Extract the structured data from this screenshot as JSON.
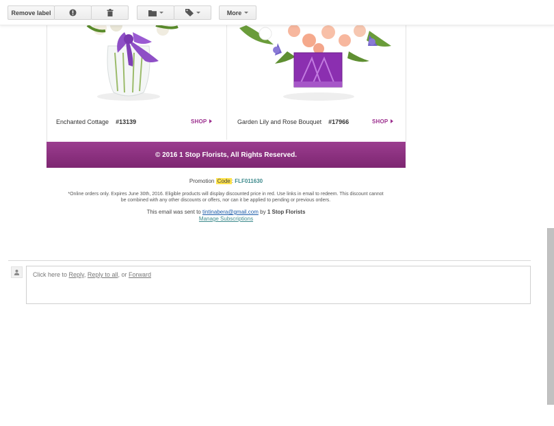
{
  "toolbar": {
    "remove_label": "Remove label",
    "more_label": "More",
    "icons": [
      "report-spam-icon",
      "delete-icon",
      "folder-icon",
      "label-tag-icon"
    ]
  },
  "products": [
    {
      "name": "Enchanted Cottage",
      "code": "#13139",
      "shop": "SHOP"
    },
    {
      "name": "Garden Lily and Rose Bouquet",
      "code": "#17966",
      "shop": "SHOP"
    }
  ],
  "footer": {
    "copyright": "© 2016 1 Stop Florists, All Rights Reserved."
  },
  "promo": {
    "prefix": "Promotion",
    "code_word": "Code",
    "separator": ":",
    "code": "FLF011630"
  },
  "disclaimer": {
    "line1": "*Online orders only. Expires June 30th, 2016. Eligible products will display discounted price in red. Use links in email to redeem. This discount cannot",
    "line2": "be combined with any other discounts or offers, nor can it be applied to pending or previous orders."
  },
  "sent_notice": {
    "prefix": "This email was sent to",
    "email": "tintinabera@gmail.com",
    "by": "by",
    "sender": "1 Stop Florists",
    "manage": "Manage Subscriptions"
  },
  "reply": {
    "prefix": "Click here to",
    "reply": "Reply",
    "comma": ",",
    "reply_all": "Reply to all",
    "or": ", or",
    "forward": "Forward"
  },
  "colors": {
    "brand_purple": "#8e3283",
    "shop_purple": "#9c2f8e",
    "promo_code_teal": "#3d8a8c",
    "highlight_yellow": "#ffe34d"
  }
}
